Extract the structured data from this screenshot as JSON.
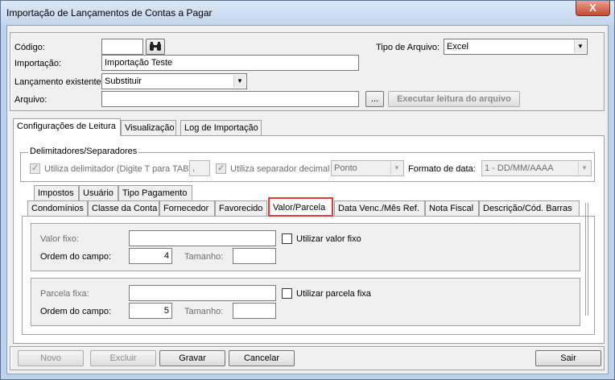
{
  "window": {
    "title": "Importação de Lançamentos de Contas a Pagar",
    "close_glyph": "X"
  },
  "form": {
    "codigo_label": "Código:",
    "codigo_value": "",
    "tipo_arquivo_label": "Tipo de Arquivo:",
    "tipo_arquivo_value": "Excel",
    "importacao_label": "Importação:",
    "importacao_value": "Importação Teste",
    "lancamento_label": "Lançamento existente:",
    "lancamento_value": "Substituir",
    "arquivo_label": "Arquivo:",
    "arquivo_value": "",
    "browse_label": "...",
    "executar_label": "Executar leitura do arquivo"
  },
  "main_tabs": [
    "Configurações de Leitura",
    "Visualização",
    "Log de Importação"
  ],
  "delimitadores": {
    "legend": "Delimitadores/Separadores",
    "utiliza_delimitador_label": "Utiliza delimitador (Digite T para TAB)",
    "delimitador_value": ",",
    "utiliza_separador_label": "Utiliza separador decimal",
    "separador_value": "Ponto",
    "formato_data_label": "Formato de data:",
    "formato_data_value": "1 - DD/MM/AAAA"
  },
  "inner_tabs_row1": [
    "Impostos",
    "Usuário",
    "Tipo Pagamento"
  ],
  "inner_tabs_row2": [
    "Condomínios",
    "Classe da Conta",
    "Fornecedor",
    "Favorecido",
    "Valor/Parcela",
    "Data Venc./Mês Ref.",
    "Nota Fiscal",
    "Descrição/Cód. Barras"
  ],
  "valor": {
    "valor_fixo_label": "Valor fixo:",
    "valor_fixo_value": "",
    "utilizar_valor_fixo_label": "Utilizar valor fixo",
    "ordem_label": "Ordem do campo:",
    "ordem_value": "4",
    "tamanho_label": "Tamanho:",
    "tamanho_value": ""
  },
  "parcela": {
    "parcela_fixa_label": "Parcela fixa:",
    "parcela_fixa_value": "",
    "utilizar_parcela_fixa_label": "Utilizar parcela fixa",
    "ordem_label": "Ordem do campo:",
    "ordem_value": "5",
    "tamanho_label": "Tamanho:",
    "tamanho_value": ""
  },
  "buttons": {
    "novo": "Novo",
    "excluir": "Excluir",
    "gravar": "Gravar",
    "cancelar": "Cancelar",
    "sair": "Sair"
  },
  "icons": {
    "search": "binoculars-icon",
    "dropdown": "chevron-down-icon"
  }
}
